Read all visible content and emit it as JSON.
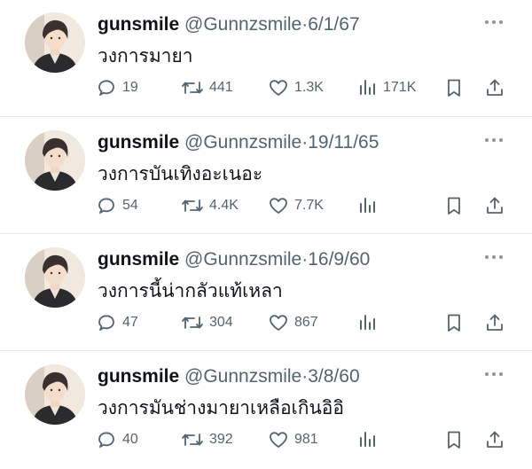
{
  "tweets": [
    {
      "name": "gunsmile",
      "handle": "@Gunnzsmile",
      "separator": "·",
      "date": "6/1/67",
      "text": "วงการมายา",
      "replies": "19",
      "retweets": "441",
      "likes": "1.3K",
      "views": "171K"
    },
    {
      "name": "gunsmile",
      "handle": "@Gunnzsmile",
      "separator": "·",
      "date": "19/11/65",
      "text": "วงการบันเทิงอะเนอะ",
      "replies": "54",
      "retweets": "4.4K",
      "likes": "7.7K",
      "views": ""
    },
    {
      "name": "gunsmile",
      "handle": "@Gunnzsmile",
      "separator": "·",
      "date": "16/9/60",
      "text": "วงการนี้น่ากลัวแท้เหลา",
      "replies": "47",
      "retweets": "304",
      "likes": "867",
      "views": ""
    },
    {
      "name": "gunsmile",
      "handle": "@Gunnzsmile",
      "separator": "·",
      "date": "3/8/60",
      "text": "วงการมันช่างมายาเหลือเกินอิอิ",
      "replies": "40",
      "retweets": "392",
      "likes": "981",
      "views": ""
    }
  ],
  "icons": {
    "more": "more-horizontal-icon",
    "reply": "reply-icon",
    "retweet": "retweet-icon",
    "like": "heart-icon",
    "views": "views-bar-chart-icon",
    "bookmark": "bookmark-icon",
    "share": "share-icon"
  },
  "colors": {
    "text": "#0f1419",
    "secondary": "#536471",
    "divider": "#e6e9ec"
  }
}
